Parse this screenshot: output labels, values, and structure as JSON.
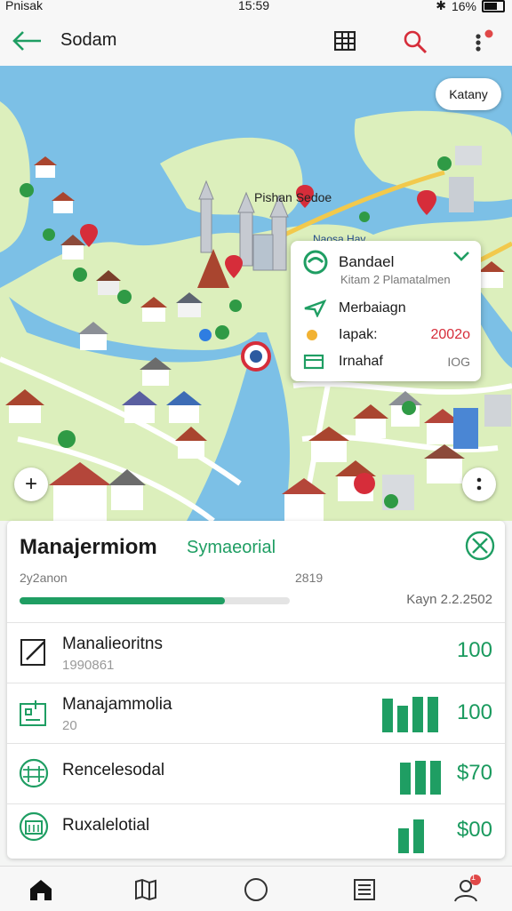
{
  "status_bar": {
    "carrier": "Pnisak",
    "time": "15:59",
    "battery": "16%"
  },
  "app_bar": {
    "title": "Sodam"
  },
  "map": {
    "chip_label": "Katany",
    "place_label": "Pishan Sedoe",
    "water_label": "Naosa Hav",
    "popup": {
      "title": "Bandael",
      "subtitle": "Kitam 2 Plamatalmen",
      "row2_label": "Merbaiagn",
      "row3_label": "Iapak:",
      "row3_value": "2002o",
      "row4_label": "Irnahaf",
      "row4_value": "IOG"
    }
  },
  "panel": {
    "title": "Manajermiom",
    "subtitle": "Symaeorial",
    "progress_left": "2y2anon",
    "progress_right": "2819",
    "progress_fraction": 0.76,
    "date_label": "Kayn 2.2.2502",
    "rows": [
      {
        "title": "Manalieoritns",
        "sub": "1990861",
        "value": "100",
        "bars": []
      },
      {
        "title": "Manajammolia",
        "sub": "20",
        "value": "100",
        "bars": [
          38,
          30,
          40,
          40
        ]
      },
      {
        "title": "Rencelesodal",
        "sub": "",
        "value": "$70",
        "bars": [
          36,
          38,
          38
        ]
      },
      {
        "title": "Ruxalelotial",
        "sub": "",
        "value": "$00",
        "bars": [
          28,
          38
        ]
      }
    ]
  },
  "bottom_nav": {
    "badge": "1"
  },
  "colors": {
    "brand_green": "#1f9e63",
    "accent_red": "#d62d3a",
    "water": "#7cc0e6",
    "land": "#d9ecb5"
  },
  "icons": [
    "back-arrow-icon",
    "grid-icon",
    "search-icon",
    "more-vert-icon",
    "add-icon",
    "home-icon",
    "map-icon",
    "circle-icon",
    "list-icon",
    "profile-icon"
  ]
}
